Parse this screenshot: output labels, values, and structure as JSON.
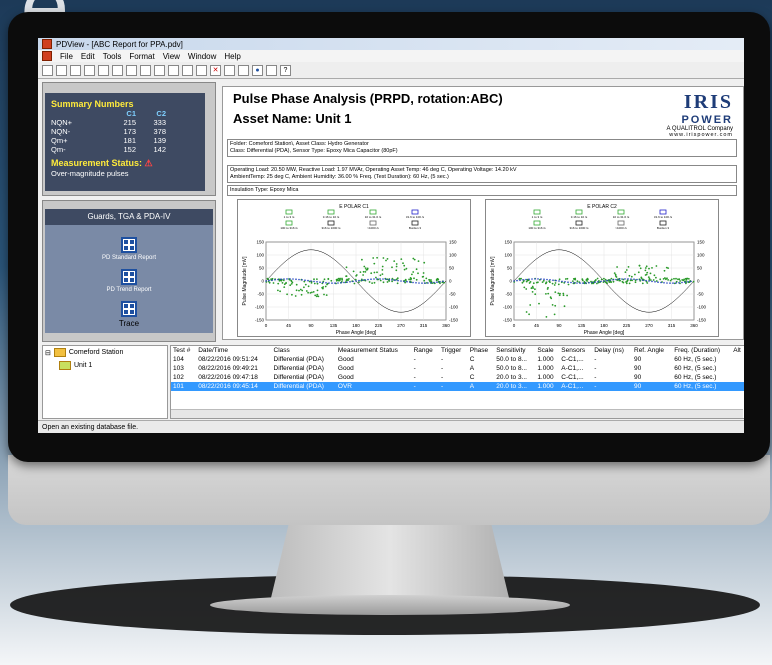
{
  "window_title": "PDView - [ABC Report for PPA.pdv]",
  "background_text": "e",
  "menu": [
    "File",
    "Edit",
    "Tools",
    "Format",
    "View",
    "Window",
    "Help"
  ],
  "summary": {
    "title": "Summary Numbers",
    "col1": "C1",
    "col2": "C2",
    "rows": [
      {
        "label": "NQN+",
        "c1": "215",
        "c2": "333"
      },
      {
        "label": "NQN-",
        "c1": "173",
        "c2": "378"
      },
      {
        "label": "Qm+",
        "c1": "181",
        "c2": "139"
      },
      {
        "label": "Qm-",
        "c1": "152",
        "c2": "142"
      }
    ],
    "status_title": "Measurement Status:",
    "status_text": "Over-magnitude pulses"
  },
  "reports_panel": {
    "header": "Guards, TGA & PDA-IV",
    "items": [
      "PD Standard Report",
      "PD Trend Report",
      "Trace"
    ]
  },
  "report": {
    "title": "Pulse Phase Analysis (PRPD, rotation:ABC)",
    "asset": "Asset Name: Unit 1",
    "logo_iris": "IRIS",
    "logo_power": "POWER",
    "logo_sub": "A QUALITROL Company",
    "logo_url": "www.irispower.com",
    "folder_line": "Folder: Comeford Station\\, Asset Class: Hydro Generator",
    "class_line": "Class: Differential (PDA), Sensor Type: Epoxy Mica Capacitor (80pF)",
    "op_line1": "Operating Load: 20.50 MW, Reactive Load: 1.97 MVAr, Operating Asset Temp: 46 deg C, Operating Voltage: 14.20 kV",
    "op_line2": "AmbientTemp: 25 deg C, Ambient Humidity: 36.00 % Freq. (Test Duration): 60 Hz, (5 sec.)",
    "insulation": "Insulation Type: Epoxy Mica"
  },
  "chart_data": [
    {
      "type": "scatter",
      "title": "E POLAR C1",
      "xlabel": "Phase Angle [deg]",
      "ylabel": "Pulse Magnitude [mV]",
      "xlim": [
        0,
        360
      ],
      "ylim": [
        -150,
        150
      ],
      "x_ticks": [
        0,
        45,
        90,
        135,
        180,
        225,
        270,
        315,
        360
      ],
      "y_ticks": [
        150,
        100,
        50,
        0,
        -50,
        -100,
        -150
      ],
      "legend": [
        "1 to 3 /s",
        "3.16 to 10 /s",
        "10 to 31.6 /s",
        "31.6 to 100 /s",
        "100 to 316 /s",
        "316 to 1000 /s",
        ">1000 /s",
        "Burden 3"
      ]
    },
    {
      "type": "scatter",
      "title": "E POLAR C2",
      "xlabel": "Phase Angle [deg]",
      "ylabel": "Pulse Magnitude [mV]",
      "xlim": [
        0,
        360
      ],
      "ylim": [
        -150,
        150
      ],
      "x_ticks": [
        0,
        45,
        90,
        135,
        180,
        225,
        270,
        315,
        360
      ],
      "y_ticks": [
        150,
        100,
        50,
        0,
        -50,
        -100,
        -150
      ],
      "legend": [
        "1 to 3 /s",
        "3.16 to 10 /s",
        "10 to 31.6 /s",
        "31.6 to 100 /s",
        "100 to 316 /s",
        "316 to 1000 /s",
        ">1000 /s",
        "Burden 3"
      ]
    }
  ],
  "tree": {
    "station": "Comeford Station",
    "unit": "Unit 1"
  },
  "grid": {
    "columns": [
      "Test #",
      "Date/Time",
      "Class",
      "Measurement Status",
      "Range",
      "Trigger",
      "Phase",
      "Sensitivity",
      "Scale",
      "Sensors",
      "Delay (ns)",
      "Ref. Angle",
      "Freq. (Duration)",
      "Alt"
    ],
    "rows": [
      [
        "104",
        "08/22/2016 09:51:24",
        "Differential (PDA)",
        "Good",
        "-",
        "-",
        "C",
        "50.0 to 8...",
        "1.000",
        "C-C1,...",
        "-",
        "90",
        "60 Hz, (5 sec.)",
        ""
      ],
      [
        "103",
        "08/22/2016 09:49:21",
        "Differential (PDA)",
        "Good",
        "-",
        "-",
        "A",
        "50.0 to 8...",
        "1.000",
        "A-C1,...",
        "-",
        "90",
        "60 Hz, (5 sec.)",
        ""
      ],
      [
        "102",
        "08/22/2016 09:47:18",
        "Differential (PDA)",
        "Good",
        "-",
        "-",
        "C",
        "20.0 to 3...",
        "1.000",
        "C-C1,...",
        "-",
        "90",
        "60 Hz, (5 sec.)",
        ""
      ],
      [
        "101",
        "08/22/2016 09:45:14",
        "Differential (PDA)",
        "OVR",
        "-",
        "-",
        "A",
        "20.0 to 3...",
        "1.000",
        "A-C1,...",
        "-",
        "90",
        "60 Hz, (5 sec.)",
        ""
      ]
    ],
    "selected_row": 3
  },
  "status": "Open an existing database file.",
  "colors": {
    "accent_yellow": "#ffeb3b",
    "panel_dark": "#3e4a62",
    "selection": "#3399ff",
    "scatter_green": "#2a9a2a",
    "scatter_blue": "#2040c0"
  }
}
